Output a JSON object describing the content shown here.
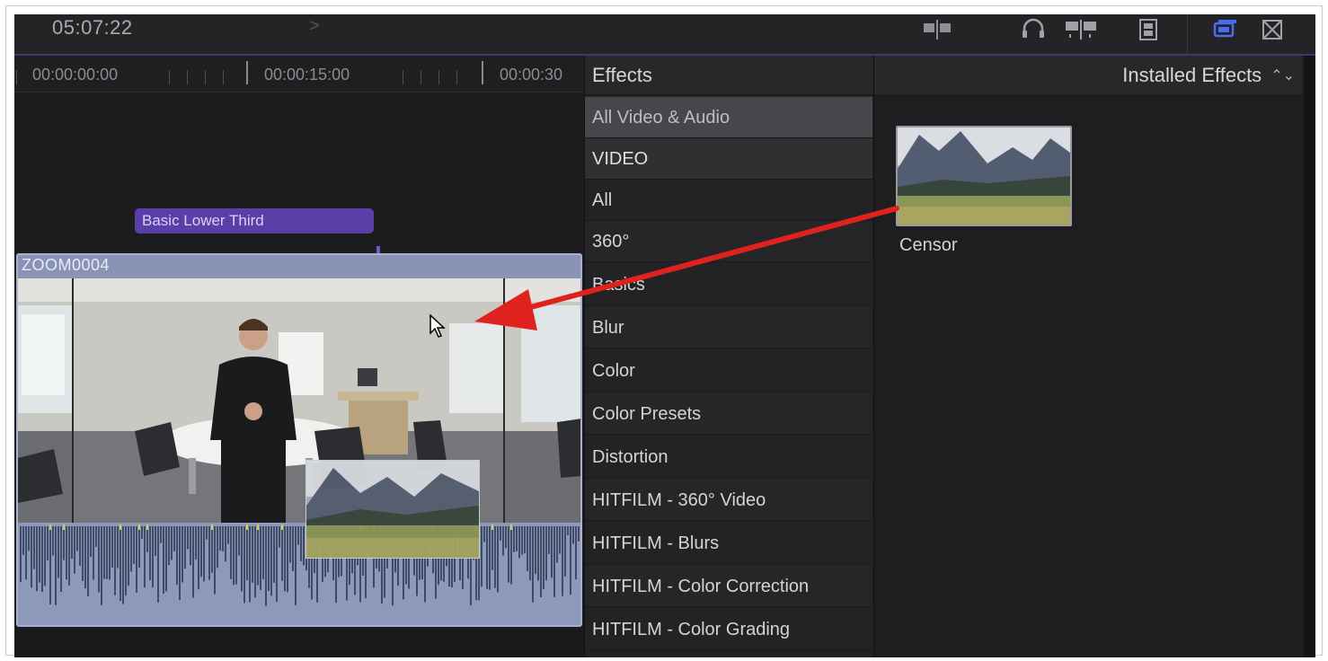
{
  "toolbar": {
    "timecode": "05:07:22",
    "nav_arrow": ">",
    "icons": [
      "clip-appearance-icon",
      "audio-headphones-icon",
      "skimming-icon",
      "film-icon",
      "browser-toggle-icon",
      "transitions-icon"
    ]
  },
  "timeline": {
    "ruler_labels": [
      "00:00:00:00",
      "00:00:15:00",
      "00:00:30"
    ],
    "title_clip": "Basic Lower Third",
    "clip_name": "ZOOM0004"
  },
  "effects": {
    "header": "Effects",
    "categories": [
      "All Video & Audio",
      "VIDEO",
      "All",
      "360°",
      "Basics",
      "Blur",
      "Color",
      "Color Presets",
      "Distortion",
      "HITFILM - 360° Video",
      "HITFILM - Blurs",
      "HITFILM - Color Correction",
      "HITFILM - Color Grading"
    ],
    "selected": "All Video & Audio"
  },
  "browser": {
    "filter_label": "Installed Effects",
    "filter_arrows": "⌃⌄",
    "items": [
      {
        "label": "Censor"
      }
    ]
  },
  "colors": {
    "accent_purple": "#5a3fa8",
    "annotation_red": "#e0221f",
    "clip_blue": "#8993b5"
  }
}
